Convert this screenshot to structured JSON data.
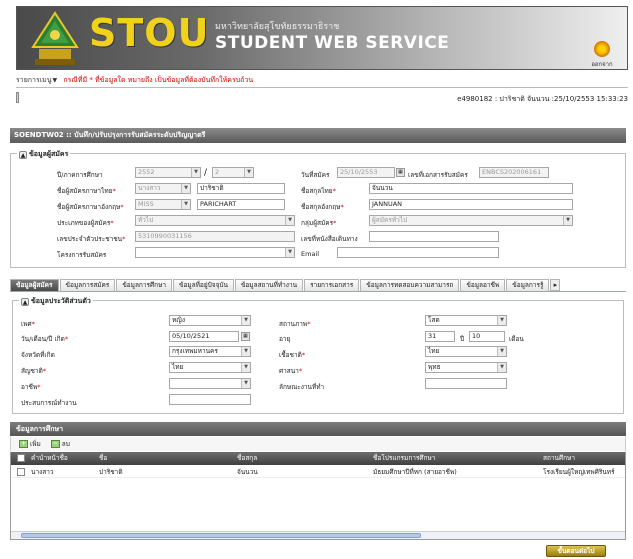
{
  "header": {
    "brand": "STOU",
    "university_thai": "มหาวิทยาลัยสุโขทัยธรรมาธิราช",
    "service": "STUDENT WEB SERVICE",
    "logout_label": "ออกจากระบบ"
  },
  "menubar": {
    "menu_label": "รายการเมนู",
    "note": "กรณีที่มี * ที่ข้อมูลใด หมายถึง เป็นข้อมูลที่ต้องบันทึกให้ครบถ้วน"
  },
  "status": {
    "user_info": "e4980182 : ปาริชาติ จันนวน :25/10/2553 15:33:23"
  },
  "page_title": "SOENDTW02 :: บันทึก/ปรับปรุงการรับสมัครระดับปริญญาตรี",
  "applicant": {
    "legend": "ข้อมูลผู้สมัคร",
    "academic_year_label": "ปี/ภาคการศึกษา",
    "academic_year": "2552",
    "semester": "2",
    "apply_date_label": "วันที่สมัคร",
    "apply_date": "25/10/2553",
    "doc_no_label": "เลขที่เอกสารรับสมัคร",
    "doc_no": "ENBCS202006161",
    "name_th_label": "ชื่อผู้สมัครภาษาไทย",
    "prefix_th": "นางสาว",
    "name_th": "ปาริชาติ",
    "surname_th_label": "ชื่อสกุลไทย",
    "surname_th": "จันนวน",
    "name_en_label": "ชื่อผู้สมัครภาษาอังกฤษ",
    "prefix_en": "MISS",
    "name_en": "PARICHART",
    "surname_en_label": "ชื่อสกุลอังกฤษ",
    "surname_en": "JANNUAN",
    "type_label": "ประเภทของผู้สมัคร",
    "type": "ทั่วไป",
    "group_label": "กลุ่มผู้สมัคร",
    "group": "ผู้สมัครทั่วไป",
    "id_card_label": "เลขประจำตัวประชาชน",
    "id_card": "5310990031156",
    "passport_label": "เลขที่หนังสือเดินทาง",
    "passport": "",
    "project_label": "โครงการรับสมัคร",
    "project": "",
    "email_label": "Email",
    "email": ""
  },
  "tabs": [
    "ข้อมูลผู้สมัคร",
    "ข้อมูลการสมัคร",
    "ข้อมูลการศึกษา",
    "ข้อมูลที่อยู่ปัจจุบัน",
    "ข้อมูลสถานที่ทำงาน",
    "รายการเอกสาร",
    "ข้อมูลการทดสอบความสามารถ",
    "ข้อมูลอาชีพ",
    "ข้อมูลการรู้"
  ],
  "personal": {
    "legend": "ข้อมูลประวัติส่วนตัว",
    "sex_label": "เพศ",
    "sex": "หญิง",
    "marital_label": "สถานภาพ",
    "marital": "โสด",
    "birth_label": "วัน/เดือน/ปี เกิด",
    "birth": "05/10/2521",
    "age_label": "อายุ",
    "age_years": "31",
    "year_unit": "ปี",
    "age_months": "10",
    "month_unit": "เดือน",
    "birth_province_label": "จังหวัดที่เกิด",
    "birth_province": "กรุงเทพมหานคร",
    "ethnicity_label": "เชื้อชาติ",
    "ethnicity": "ไทย",
    "nationality_label": "สัญชาติ",
    "nationality": "ไทย",
    "religion_label": "ศาสนา",
    "religion": "พุทธ",
    "occupation_label": "อาชีพ",
    "occupation": "",
    "job_char_label": "ลักษณะงานที่ทำ",
    "job_char": "",
    "work_exp_label": "ประสบการณ์ทำงาน",
    "work_exp": ""
  },
  "study": {
    "section_title": "ข้อมูลการศึกษา",
    "add_label": "เพิ่ม",
    "delete_label": "ลบ",
    "columns": [
      "คำนำหน้าชื่อ",
      "ชื่อ",
      "ชื่อสกุล",
      "ชื่อโปรแกรมการศึกษา",
      "สถานศึกษา"
    ],
    "rows": [
      [
        "นางสาว",
        "ปาริชาติ",
        "จันนวน",
        "มัธยมศึกษาปีที่หก (สายอาชีพ)",
        "โรงเรียนผู้ใหญ่เทพศิรินทร์"
      ]
    ]
  },
  "next_label": "ขั้นตอนต่อไป"
}
